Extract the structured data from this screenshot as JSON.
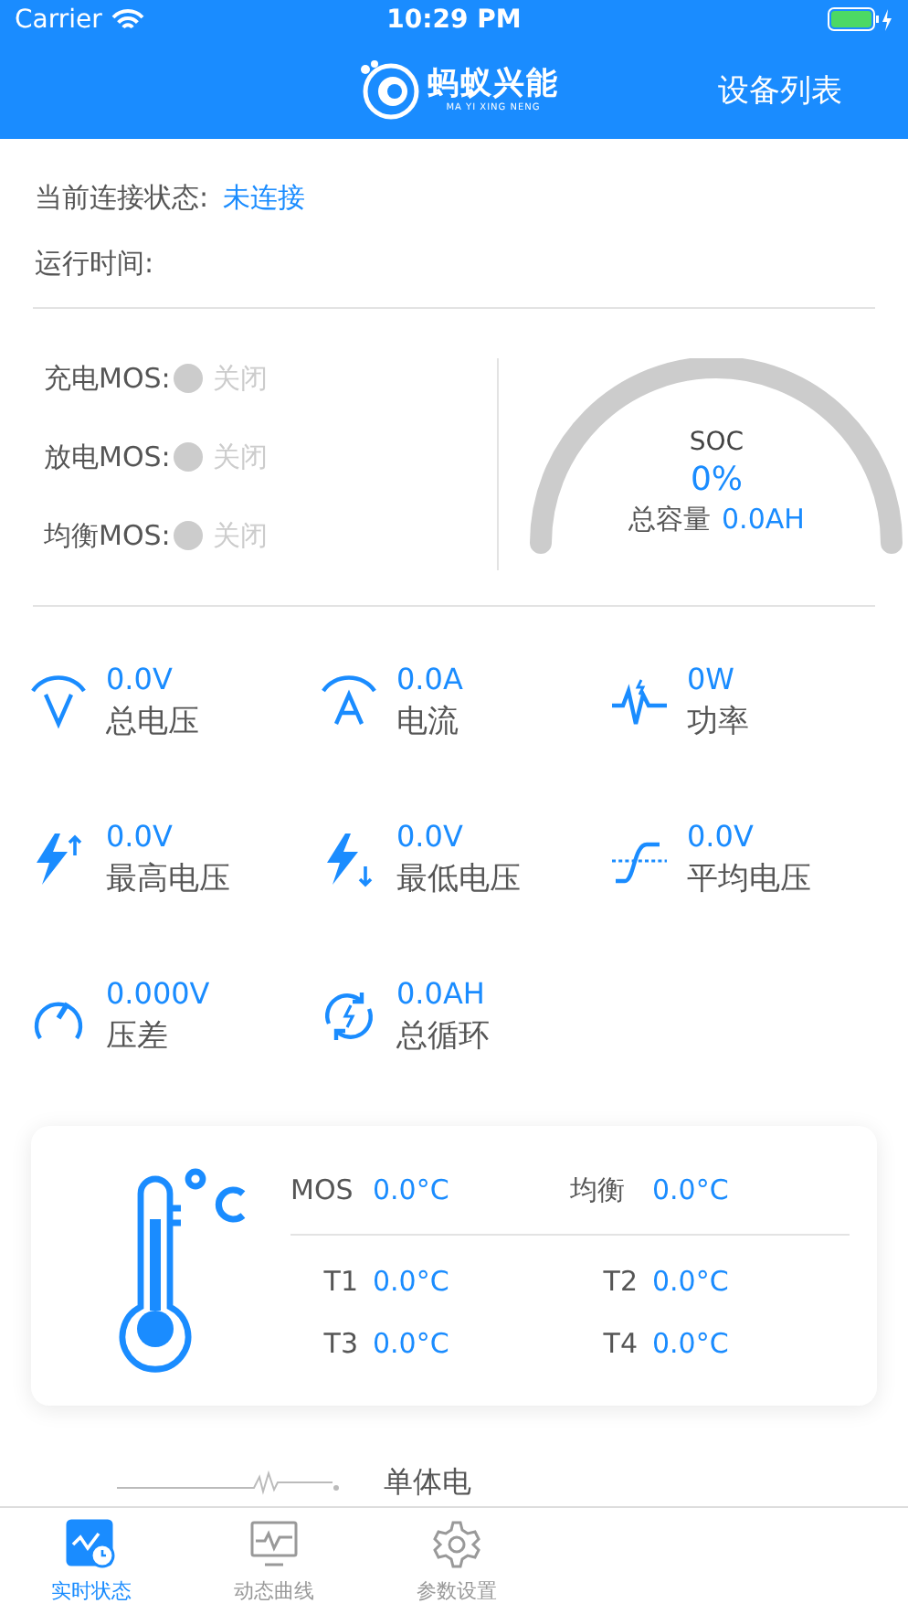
{
  "status_bar": {
    "carrier": "Carrier",
    "time": "10:29 PM"
  },
  "nav": {
    "logo_text": "蚂蚁兴能",
    "logo_subtext": "MA YI XING NENG",
    "right_button": "设备列表"
  },
  "connection": {
    "label": "当前连接状态:",
    "value": "未连接",
    "runtime_label": "运行时间:"
  },
  "mos": [
    {
      "label": "充电MOS:",
      "state": "关闭",
      "on": false
    },
    {
      "label": "放电MOS:",
      "state": "关闭",
      "on": false
    },
    {
      "label": "均衡MOS:",
      "state": "关闭",
      "on": false
    }
  ],
  "soc": {
    "title": "SOC",
    "value": "0%",
    "capacity_label": "总容量",
    "capacity_value": "0.0AH"
  },
  "metrics": [
    {
      "kind": "voltage",
      "value": "0.0V",
      "label": "总电压"
    },
    {
      "kind": "current",
      "value": "0.0A",
      "label": "电流"
    },
    {
      "kind": "power",
      "value": "0W",
      "label": "功率"
    },
    {
      "kind": "max",
      "value": "0.0V",
      "label": "最高电压"
    },
    {
      "kind": "min",
      "value": "0.0V",
      "label": "最低电压"
    },
    {
      "kind": "avg",
      "value": "0.0V",
      "label": "平均电压"
    },
    {
      "kind": "diff",
      "value": "0.000V",
      "label": "压差"
    },
    {
      "kind": "cycle",
      "value": "0.0AH",
      "label": "总循环"
    }
  ],
  "temperatures": {
    "top": [
      {
        "label": "MOS",
        "value": "0.0°C"
      },
      {
        "label": "均衡",
        "value": "0.0°C"
      }
    ],
    "bottom": [
      {
        "label": "T1",
        "value": "0.0°C"
      },
      {
        "label": "T2",
        "value": "0.0°C"
      },
      {
        "label": "T3",
        "value": "0.0°C"
      },
      {
        "label": "T4",
        "value": "0.0°C"
      }
    ]
  },
  "section_title": "单体电",
  "tabs": [
    {
      "kind": "realtime",
      "label": "实时状态",
      "selected": true
    },
    {
      "kind": "curve",
      "label": "动态曲线",
      "selected": false
    },
    {
      "kind": "settings",
      "label": "参数设置",
      "selected": false
    }
  ]
}
